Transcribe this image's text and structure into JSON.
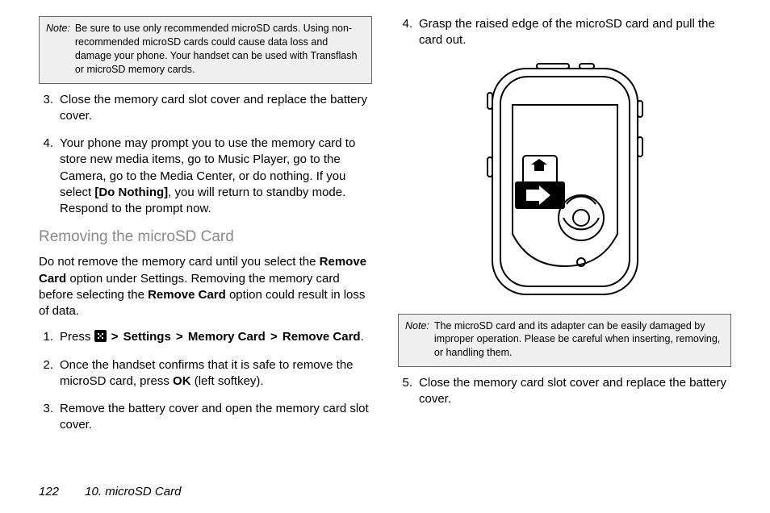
{
  "left": {
    "note1": {
      "label": "Note:",
      "text": "Be sure to use only recommended microSD cards. Using non-recommended microSD cards could cause data loss and damage your phone. Your handset can be used with Transflash or microSD memory cards."
    },
    "step3": {
      "num": "3.",
      "text": "Close the memory card slot cover and replace the battery cover."
    },
    "step4": {
      "num": "4.",
      "pre": "Your phone may prompt you to use the memory card to store new media items, go to Music Player, go to the Camera, go to the Media Center, or do nothing. If you select ",
      "bold": "[Do Nothing]",
      "post": ", you will return to standby mode. Respond to the prompt now."
    },
    "subhead": "Removing the microSD Card",
    "para": {
      "p1": "Do not remove the memory card until you select the ",
      "b1": "Remove Card",
      "p2": " option under Settings. Removing the memory card before selecting the ",
      "b2": "Remove Card",
      "p3": " option could result in loss of data."
    },
    "r1": {
      "num": "1.",
      "press": "Press ",
      "settings": "Settings",
      "memcard": "Memory Card",
      "remove": "Remove Card",
      "dot": "."
    },
    "r2": {
      "num": "2.",
      "pre": "Once the handset confirms that it is safe to remove the microSD card, press ",
      "ok": "OK",
      "post": " (left softkey)."
    },
    "r3": {
      "num": "3.",
      "text": "Remove the battery cover and open the memory card slot cover."
    }
  },
  "right": {
    "step4": {
      "num": "4.",
      "text": "Grasp the raised edge of the microSD card and pull the card out."
    },
    "note2": {
      "label": "Note:",
      "text": "The microSD card and its adapter can be easily damaged by improper operation. Please be careful when inserting, removing, or handling them."
    },
    "step5": {
      "num": "5.",
      "text": "Close the memory card slot cover and replace the battery cover."
    }
  },
  "footer": {
    "page": "122",
    "title": "10. microSD Card"
  },
  "gt": ">"
}
